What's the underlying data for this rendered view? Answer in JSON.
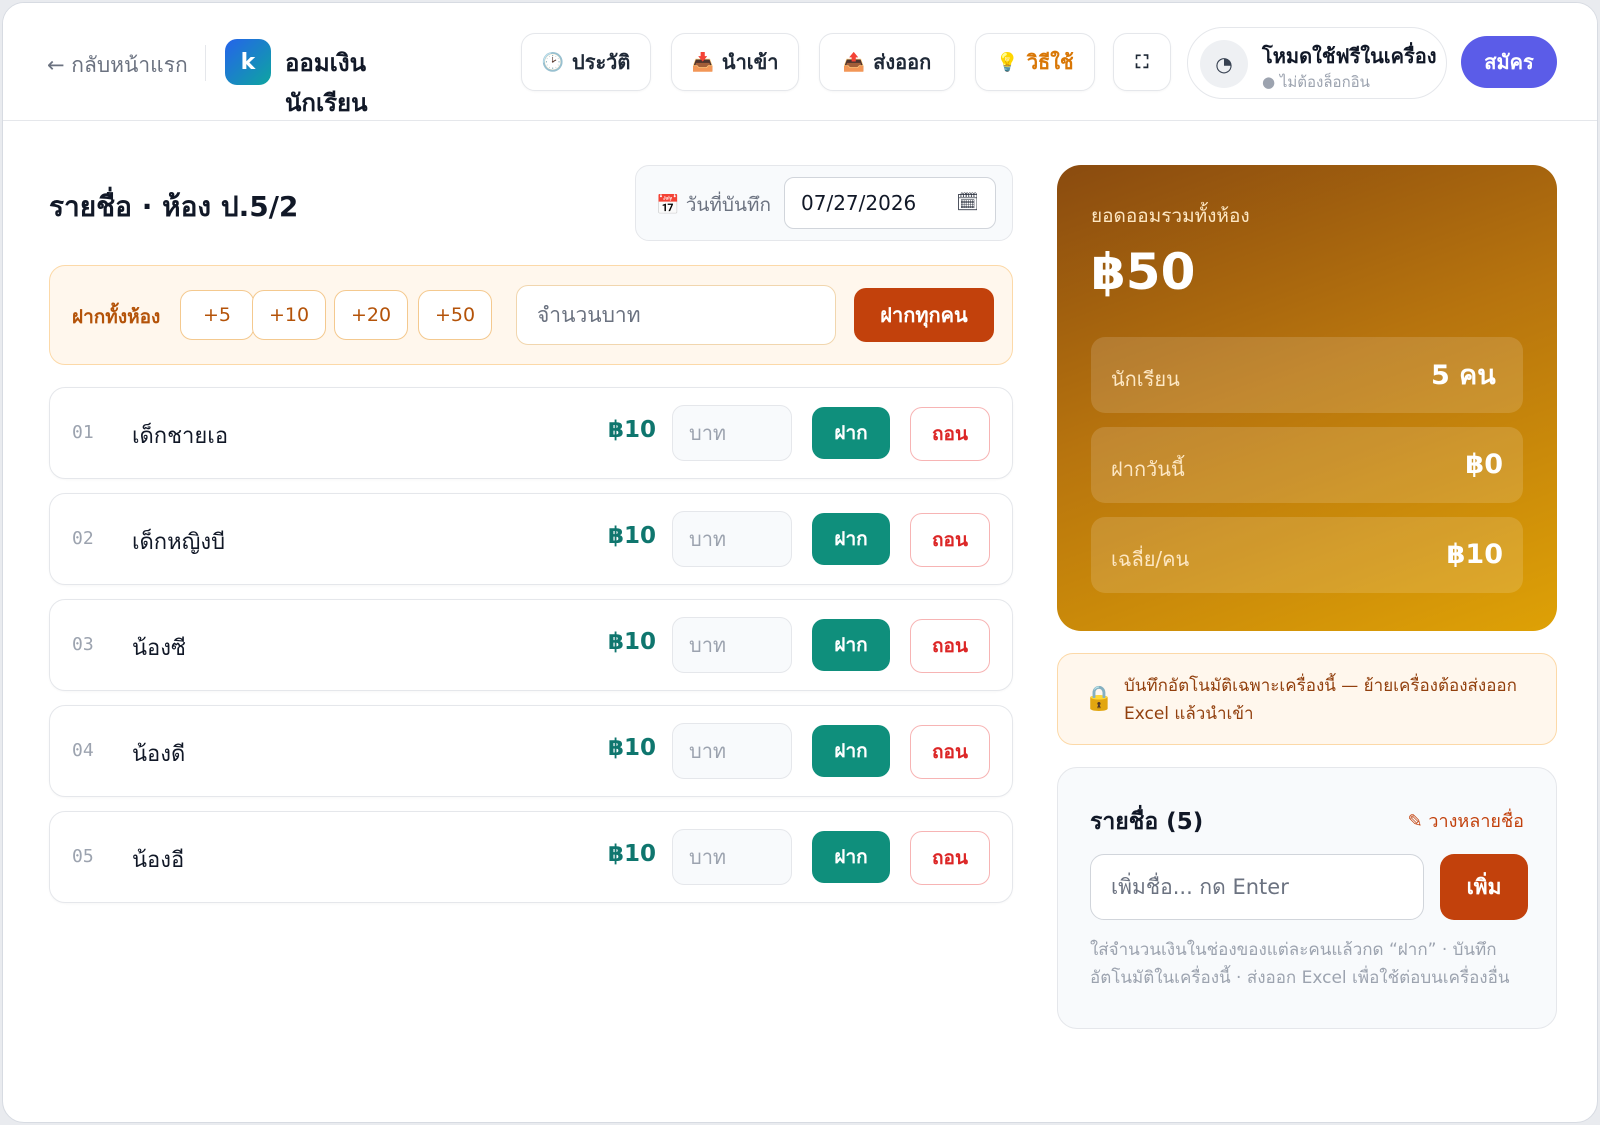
{
  "header": {
    "back_label": "← กลับหน้าแรก",
    "logo_letter": "k",
    "app_title": "ออมเงิน นักเรียน",
    "buttons": [
      {
        "icon": "clock-icon",
        "glyph": "🕑",
        "label": "ประวัติ"
      },
      {
        "icon": "import-icon",
        "glyph": "📥",
        "label": "นำเข้า"
      },
      {
        "icon": "export-icon",
        "glyph": "📤",
        "label": "ส่งออก"
      },
      {
        "icon": "lightbulb-icon",
        "glyph": "💡",
        "label": "วิธีใช้"
      },
      {
        "icon": "fullscreen-icon",
        "glyph": "⛶",
        "label": ""
      }
    ],
    "mode": {
      "icon_glyph": "◔",
      "title": "โหมดใช้ฟรีในเครื่อง",
      "subtitle": "● ไม่ต้องล็อกอิน"
    },
    "signup_label": "สมัคร"
  },
  "main": {
    "list_title": "รายชื่อ · ห้อง ป.5/2",
    "date": {
      "label": "📅 วันที่บันทึก",
      "value": "07/27/2026",
      "icon_glyph": "🗓"
    },
    "bulk": {
      "label": "ฝากทั้งห้อง",
      "chips": [
        "+5",
        "+10",
        "+20",
        "+50"
      ],
      "input_placeholder": "จำนวนบาท",
      "button_label": "ฝากทุกคน"
    },
    "students": [
      {
        "num": "01",
        "name": "เด็กชายเอ",
        "balance": "฿10",
        "input_placeholder": "บาท",
        "deposit": "ฝาก",
        "withdraw": "ถอน"
      },
      {
        "num": "02",
        "name": "เด็กหญิงบี",
        "balance": "฿10",
        "input_placeholder": "บาท",
        "deposit": "ฝาก",
        "withdraw": "ถอน"
      },
      {
        "num": "03",
        "name": "น้องซี",
        "balance": "฿10",
        "input_placeholder": "บาท",
        "deposit": "ฝาก",
        "withdraw": "ถอน"
      },
      {
        "num": "04",
        "name": "น้องดี",
        "balance": "฿10",
        "input_placeholder": "บาท",
        "deposit": "ฝาก",
        "withdraw": "ถอน"
      },
      {
        "num": "05",
        "name": "น้องอี",
        "balance": "฿10",
        "input_placeholder": "บาท",
        "deposit": "ฝาก",
        "withdraw": "ถอน"
      }
    ]
  },
  "summary": {
    "total_label": "ยอดออมรวมทั้งห้อง",
    "total_value": "฿50",
    "stats": [
      {
        "label": "นักเรียน",
        "value": "5 คน"
      },
      {
        "label": "ฝากวันนี้",
        "value": "฿0"
      },
      {
        "label": "เฉลี่ย/คน",
        "value": "฿10"
      }
    ]
  },
  "notice": {
    "icon": "lock-icon",
    "glyph": "🔒",
    "text": "บันทึกอัตโนมัติเฉพาะเครื่องนี้ — ย้ายเครื่องต้องส่งออก Excel แล้วนำเข้า"
  },
  "names": {
    "title": "รายชื่อ (5)",
    "paste_label": "✎ วางหลายชื่อ",
    "input_placeholder": "เพิ่มชื่อ... กด Enter",
    "add_label": "เพิ่ม",
    "help": "ใส่จำนวนเงินในช่องของแต่ละคนแล้วกด “ฝาก” · บันทึกอัตโนมัติในเครื่องนี้ · ส่งออก Excel เพื่อใช้ต่อบนเครื่องอื่น"
  },
  "colors": {
    "accent_teal": "#0f8f7c",
    "accent_orange": "#c2410c",
    "signup_purple": "#5b5ce8",
    "withdraw_red": "#dc2626"
  }
}
